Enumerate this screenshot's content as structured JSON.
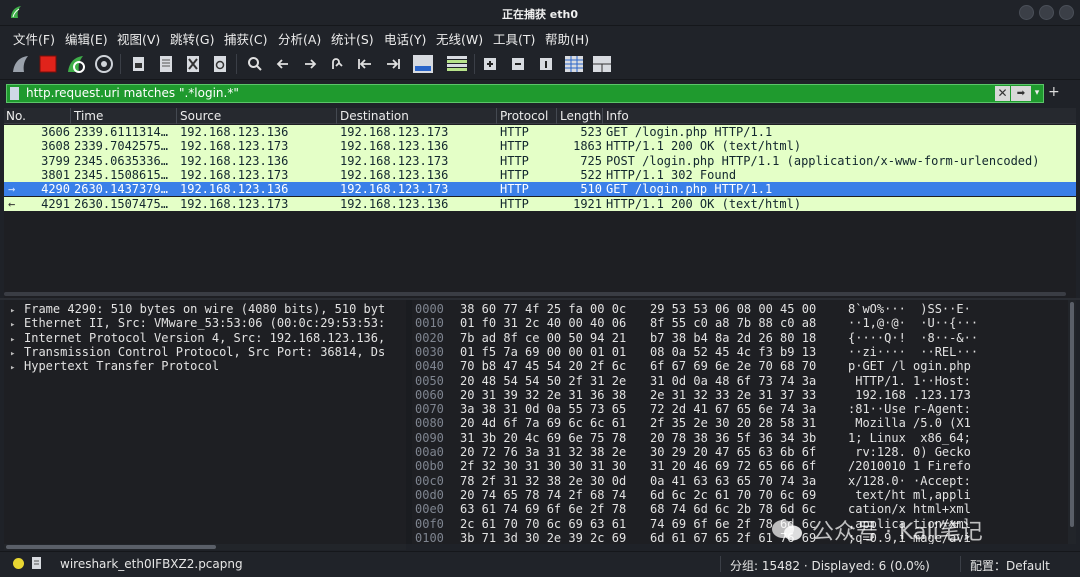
{
  "window": {
    "title": "正在捕获 eth0"
  },
  "menu": {
    "items": [
      "文件(F)",
      "编辑(E)",
      "视图(V)",
      "跳转(G)",
      "捕获(C)",
      "分析(A)",
      "统计(S)",
      "电话(Y)",
      "无线(W)",
      "工具(T)",
      "帮助(H)"
    ]
  },
  "toolbar": {
    "icons": [
      "shark-fin-start-icon",
      "stop-square-icon",
      "restart-icon",
      "options-gear-icon",
      "open-file-icon",
      "save-file-icon",
      "close-file-icon",
      "reload-icon",
      "find-icon",
      "back-arrow-icon",
      "forward-arrow-icon",
      "go-to-packet-icon",
      "first-packet-icon",
      "last-packet-icon",
      "autoscroll-icon",
      "colorize-icon",
      "zoom-in-icon",
      "zoom-out-icon",
      "normal-size-icon",
      "resize-columns-icon",
      "layout-icon"
    ]
  },
  "filter": {
    "text": "http.request.uri matches \".*login.*\"",
    "apply_glyph": "➡",
    "clear_glyph": "✕",
    "dropdown_glyph": "▾",
    "plus_glyph": "+",
    "background": "#1f9a2e"
  },
  "packet_list": {
    "columns": [
      "No.",
      "Time",
      "Source",
      "Destination",
      "Protocol",
      "Length",
      "Info"
    ],
    "rows": [
      {
        "no": "3606",
        "time": "2339.6111314…",
        "src": "192.168.123.136",
        "dst": "192.168.123.173",
        "proto": "HTTP",
        "len": "523",
        "info": "GET /login.php HTTP/1.1",
        "marker": "",
        "selected": false
      },
      {
        "no": "3608",
        "time": "2339.7042575…",
        "src": "192.168.123.173",
        "dst": "192.168.123.136",
        "proto": "HTTP",
        "len": "1863",
        "info": "HTTP/1.1 200 OK  (text/html)",
        "marker": "",
        "selected": false
      },
      {
        "no": "3799",
        "time": "2345.0635336…",
        "src": "192.168.123.136",
        "dst": "192.168.123.173",
        "proto": "HTTP",
        "len": "725",
        "info": "POST /login.php HTTP/1.1  (application/x-www-form-urlencoded)",
        "marker": "",
        "selected": false
      },
      {
        "no": "3801",
        "time": "2345.1508615…",
        "src": "192.168.123.173",
        "dst": "192.168.123.136",
        "proto": "HTTP",
        "len": "522",
        "info": "HTTP/1.1 302 Found",
        "marker": "",
        "selected": false
      },
      {
        "no": "4290",
        "time": "2630.1437379…",
        "src": "192.168.123.136",
        "dst": "192.168.123.173",
        "proto": "HTTP",
        "len": "510",
        "info": "GET /login.php HTTP/1.1",
        "marker": "→",
        "selected": true
      },
      {
        "no": "4291",
        "time": "2630.1507475…",
        "src": "192.168.123.173",
        "dst": "192.168.123.136",
        "proto": "HTTP",
        "len": "1921",
        "info": "HTTP/1.1 200 OK  (text/html)",
        "marker": "←",
        "selected": false
      }
    ],
    "row_color": "#e4ffc7",
    "selected_color": "#3a7fe8"
  },
  "details": {
    "lines": [
      "Frame 4290: 510 bytes on wire (4080 bits), 510 byt",
      "Ethernet II, Src: VMware_53:53:06 (00:0c:29:53:53:",
      "Internet Protocol Version 4, Src: 192.168.123.136,",
      "Transmission Control Protocol, Src Port: 36814, Ds",
      "Hypertext Transfer Protocol"
    ],
    "expander_glyph": "▸"
  },
  "bytes": {
    "lines": [
      {
        "off": "0000",
        "h1": "38 60 77 4f 25 fa 00 0c",
        "h2": "29 53 53 06 08 00 45 00",
        "asc": "8`wO%···  )SS··E·"
      },
      {
        "off": "0010",
        "h1": "01 f0 31 2c 40 00 40 06",
        "h2": "8f 55 c0 a8 7b 88 c0 a8",
        "asc": "··1,@·@·  ·U··{···"
      },
      {
        "off": "0020",
        "h1": "7b ad 8f ce 00 50 94 21",
        "h2": "b7 38 b4 8a 2d 26 80 18",
        "asc": "{····Q·!  ·8··-&··"
      },
      {
        "off": "0030",
        "h1": "01 f5 7a 69 00 00 01 01",
        "h2": "08 0a 52 45 4c f3 b9 13",
        "asc": "··zi····  ··REL···"
      },
      {
        "off": "0040",
        "h1": "70 b8 47 45 54 20 2f 6c",
        "h2": "6f 67 69 6e 2e 70 68 70",
        "asc": "p·GET /l ogin.php"
      },
      {
        "off": "0050",
        "h1": "20 48 54 54 50 2f 31 2e",
        "h2": "31 0d 0a 48 6f 73 74 3a",
        "asc": " HTTP/1. 1··Host:"
      },
      {
        "off": "0060",
        "h1": "20 31 39 32 2e 31 36 38",
        "h2": "2e 31 32 33 2e 31 37 33",
        "asc": " 192.168 .123.173"
      },
      {
        "off": "0070",
        "h1": "3a 38 31 0d 0a 55 73 65",
        "h2": "72 2d 41 67 65 6e 74 3a",
        "asc": ":81··Use r-Agent:"
      },
      {
        "off": "0080",
        "h1": "20 4d 6f 7a 69 6c 6c 61",
        "h2": "2f 35 2e 30 20 28 58 31",
        "asc": " Mozilla /5.0 (X1"
      },
      {
        "off": "0090",
        "h1": "31 3b 20 4c 69 6e 75 78",
        "h2": "20 78 38 36 5f 36 34 3b",
        "asc": "1; Linux  x86_64;"
      },
      {
        "off": "00a0",
        "h1": "20 72 76 3a 31 32 38 2e",
        "h2": "30 29 20 47 65 63 6b 6f",
        "asc": " rv:128. 0) Gecko"
      },
      {
        "off": "00b0",
        "h1": "2f 32 30 31 30 30 31 30",
        "h2": "31 20 46 69 72 65 66 6f",
        "asc": "/2010010 1 Firefo"
      },
      {
        "off": "00c0",
        "h1": "78 2f 31 32 38 2e 30 0d",
        "h2": "0a 41 63 63 65 70 74 3a",
        "asc": "x/128.0· ·Accept:"
      },
      {
        "off": "00d0",
        "h1": "20 74 65 78 74 2f 68 74",
        "h2": "6d 6c 2c 61 70 70 6c 69",
        "asc": " text/ht ml,appli"
      },
      {
        "off": "00e0",
        "h1": "63 61 74 69 6f 6e 2f 78",
        "h2": "68 74 6d 6c 2b 78 6d 6c",
        "asc": "cation/x html+xml"
      },
      {
        "off": "00f0",
        "h1": "2c 61 70 70 6c 69 63 61",
        "h2": "74 69 6f 6e 2f 78 6d 6c",
        "asc": ",applica tion/xml"
      },
      {
        "off": "0100",
        "h1": "3b 71 3d 30 2e 39 2c 69",
        "h2": "6d 61 67 65 2f 61 76 69",
        "asc": ";q=0.9,i mage/avi"
      }
    ]
  },
  "status": {
    "file": "wireshark_eth0IFBXZ2.pcapng",
    "stats": "分组: 15482 · Displayed: 6 (0.0%)",
    "profile": "配置：Default"
  },
  "watermark": {
    "text": "公众号 · Kali笔记"
  }
}
